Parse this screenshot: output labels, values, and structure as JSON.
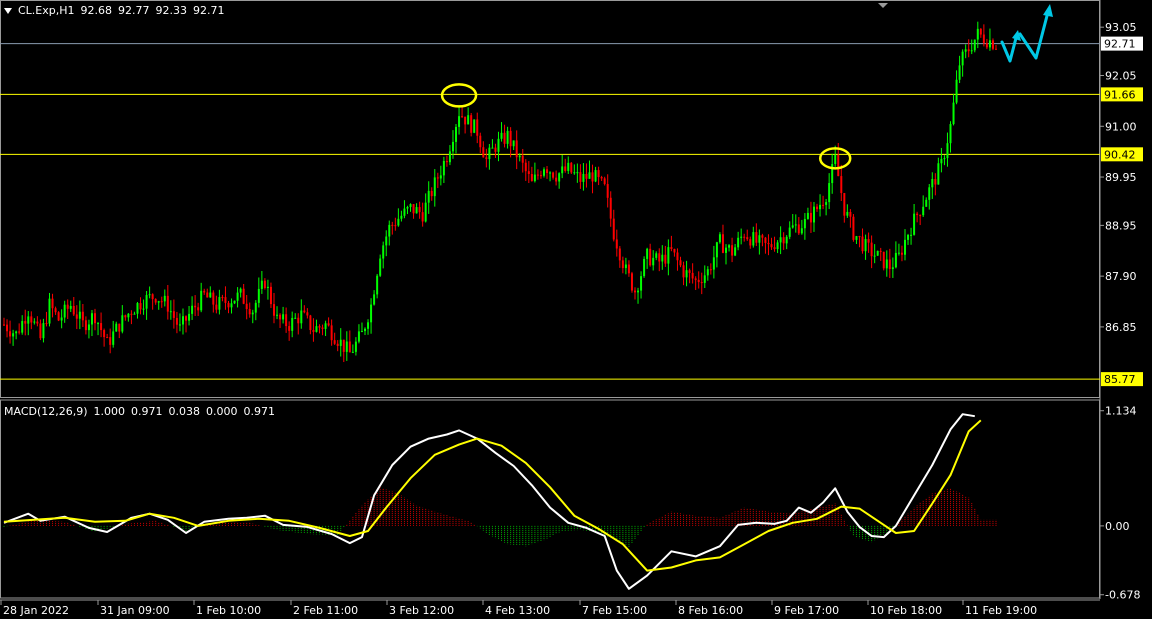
{
  "header": {
    "symbol": "CL.Exp,H1",
    "open": "92.68",
    "high": "92.77",
    "low": "92.33",
    "close": "92.71"
  },
  "macd_header": {
    "name": "MACD(12,26,9)",
    "v1": "1.000",
    "v2": "0.971",
    "v3": "0.038",
    "v4": "0.000",
    "v5": "0.971"
  },
  "colors": {
    "background": "#000000",
    "bull_candle": "#00ff00",
    "bear_candle": "#ff0000",
    "level_line": "#ffff00",
    "price_line": "#8a9bb0",
    "macd_line": "#ffffff",
    "signal_line": "#ffff00",
    "hist_pos": "#cc0000",
    "hist_neg": "#00aa00",
    "arrow": "#00c8e6"
  },
  "chart_data": [
    {
      "type": "candlestick",
      "title": "CL.Exp,H1",
      "ylim": [
        85.4,
        93.55
      ],
      "y_ticks": [
        "93.05",
        "92.05",
        "91.00",
        "89.95",
        "88.95",
        "87.90",
        "86.85"
      ],
      "y_tick_values": [
        93.05,
        92.05,
        91.0,
        89.95,
        88.95,
        87.9,
        86.85
      ],
      "x_ticks": [
        "28 Jan 2022",
        "31 Jan 09:00",
        "1 Feb 10:00",
        "2 Feb 11:00",
        "3 Feb 12:00",
        "4 Feb 13:00",
        "7 Feb 15:00",
        "8 Feb 16:00",
        "9 Feb 17:00",
        "10 Feb 18:00",
        "11 Feb 19:00"
      ],
      "horizontal_levels": [
        {
          "label": "91.66",
          "value": 91.66,
          "color": "#ffff00"
        },
        {
          "label": "90.42",
          "value": 90.42,
          "color": "#ffff00"
        },
        {
          "label": "85.77",
          "value": 85.77,
          "color": "#ffff00"
        }
      ],
      "current_price": {
        "label": "92.71",
        "value": 92.71
      },
      "close_path": [
        [
          0,
          86.9
        ],
        [
          4,
          86.7
        ],
        [
          8,
          87.2
        ],
        [
          12,
          86.6
        ],
        [
          15,
          87.3
        ],
        [
          18,
          87.0
        ],
        [
          22,
          87.3
        ],
        [
          26,
          86.9
        ],
        [
          30,
          87.1
        ],
        [
          34,
          86.5
        ],
        [
          38,
          86.9
        ],
        [
          42,
          87.2
        ],
        [
          46,
          87.4
        ],
        [
          50,
          87.5
        ],
        [
          54,
          87.3
        ],
        [
          58,
          86.8
        ],
        [
          62,
          87.2
        ],
        [
          66,
          87.5
        ],
        [
          70,
          87.3
        ],
        [
          74,
          87.4
        ],
        [
          78,
          87.5
        ],
        [
          82,
          87.2
        ],
        [
          86,
          87.8
        ],
        [
          90,
          87.0
        ],
        [
          94,
          86.9
        ],
        [
          98,
          87.1
        ],
        [
          102,
          86.8
        ],
        [
          106,
          86.9
        ],
        [
          110,
          86.6
        ],
        [
          114,
          86.3
        ],
        [
          118,
          86.7
        ],
        [
          121,
          87.3
        ],
        [
          124,
          88.4
        ],
        [
          127,
          88.9
        ],
        [
          130,
          89.1
        ],
        [
          134,
          89.3
        ],
        [
          138,
          89.2
        ],
        [
          142,
          89.8
        ],
        [
          146,
          90.4
        ],
        [
          150,
          91.3
        ],
        [
          153,
          91.1
        ],
        [
          156,
          90.9
        ],
        [
          159,
          90.3
        ],
        [
          162,
          90.6
        ],
        [
          166,
          90.8
        ],
        [
          170,
          90.3
        ],
        [
          174,
          89.8
        ],
        [
          178,
          90.2
        ],
        [
          182,
          90.0
        ],
        [
          186,
          90.1
        ],
        [
          190,
          89.9
        ],
        [
          194,
          90.0
        ],
        [
          198,
          89.7
        ],
        [
          201,
          88.8
        ],
        [
          205,
          88.0
        ],
        [
          208,
          87.6
        ],
        [
          212,
          88.3
        ],
        [
          216,
          88.2
        ],
        [
          220,
          88.4
        ],
        [
          224,
          88.0
        ],
        [
          228,
          87.8
        ],
        [
          232,
          88.0
        ],
        [
          236,
          88.6
        ],
        [
          240,
          88.4
        ],
        [
          244,
          88.8
        ],
        [
          248,
          88.6
        ],
        [
          252,
          88.5
        ],
        [
          256,
          88.7
        ],
        [
          260,
          88.9
        ],
        [
          264,
          89.0
        ],
        [
          268,
          89.3
        ],
        [
          271,
          89.6
        ],
        [
          274,
          90.3
        ],
        [
          277,
          89.3
        ],
        [
          280,
          88.8
        ],
        [
          284,
          88.5
        ],
        [
          288,
          88.3
        ],
        [
          292,
          88.1
        ],
        [
          295,
          88.3
        ],
        [
          298,
          88.8
        ],
        [
          302,
          89.3
        ],
        [
          306,
          89.8
        ],
        [
          309,
          90.2
        ],
        [
          312,
          91.0
        ],
        [
          315,
          92.3
        ],
        [
          318,
          92.6
        ],
        [
          321,
          92.9
        ],
        [
          324,
          92.8
        ],
        [
          327,
          92.71
        ]
      ],
      "forecast_arrows_count": 2
    },
    {
      "type": "line",
      "title": "MACD(12,26,9)",
      "ylim": [
        -0.72,
        1.22
      ],
      "y_ticks": [
        "1.134",
        "0.00",
        "-0.678"
      ],
      "y_tick_values": [
        1.134,
        0.0,
        -0.678
      ],
      "series": [
        {
          "name": "",
          "color": "#ffffff",
          "points": [
            [
              0,
              0.03
            ],
            [
              8,
              0.12
            ],
            [
              12,
              0.05
            ],
            [
              20,
              0.09
            ],
            [
              28,
              -0.02
            ],
            [
              34,
              -0.06
            ],
            [
              42,
              0.08
            ],
            [
              48,
              0.12
            ],
            [
              54,
              0.06
            ],
            [
              60,
              -0.07
            ],
            [
              66,
              0.04
            ],
            [
              74,
              0.07
            ],
            [
              80,
              0.08
            ],
            [
              86,
              0.1
            ],
            [
              92,
              0.01
            ],
            [
              100,
              -0.01
            ],
            [
              108,
              -0.08
            ],
            [
              114,
              -0.17
            ],
            [
              118,
              -0.11
            ],
            [
              122,
              0.3
            ],
            [
              128,
              0.6
            ],
            [
              134,
              0.78
            ],
            [
              140,
              0.86
            ],
            [
              146,
              0.9
            ],
            [
              150,
              0.94
            ],
            [
              156,
              0.86
            ],
            [
              162,
              0.72
            ],
            [
              168,
              0.59
            ],
            [
              174,
              0.4
            ],
            [
              180,
              0.18
            ],
            [
              186,
              0.03
            ],
            [
              192,
              -0.02
            ],
            [
              198,
              -0.1
            ],
            [
              202,
              -0.44
            ],
            [
              206,
              -0.62
            ],
            [
              212,
              -0.49
            ],
            [
              220,
              -0.25
            ],
            [
              228,
              -0.3
            ],
            [
              236,
              -0.2
            ],
            [
              242,
              0.01
            ],
            [
              248,
              0.03
            ],
            [
              254,
              0.02
            ],
            [
              258,
              0.05
            ],
            [
              262,
              0.18
            ],
            [
              266,
              0.13
            ],
            [
              270,
              0.23
            ],
            [
              274,
              0.37
            ],
            [
              278,
              0.14
            ],
            [
              282,
              -0.01
            ],
            [
              286,
              -0.1
            ],
            [
              290,
              -0.11
            ],
            [
              294,
              0.0
            ],
            [
              300,
              0.3
            ],
            [
              306,
              0.6
            ],
            [
              312,
              0.95
            ],
            [
              316,
              1.1
            ],
            [
              320,
              1.08
            ]
          ]
        },
        {
          "name": "",
          "color": "#ffff00",
          "points": [
            [
              0,
              0.04
            ],
            [
              10,
              0.06
            ],
            [
              20,
              0.08
            ],
            [
              30,
              0.04
            ],
            [
              40,
              0.05
            ],
            [
              48,
              0.12
            ],
            [
              56,
              0.08
            ],
            [
              64,
              0.0
            ],
            [
              74,
              0.05
            ],
            [
              84,
              0.07
            ],
            [
              94,
              0.05
            ],
            [
              104,
              -0.02
            ],
            [
              114,
              -0.1
            ],
            [
              120,
              -0.05
            ],
            [
              126,
              0.18
            ],
            [
              134,
              0.47
            ],
            [
              142,
              0.7
            ],
            [
              150,
              0.8
            ],
            [
              156,
              0.86
            ],
            [
              164,
              0.79
            ],
            [
              172,
              0.62
            ],
            [
              180,
              0.38
            ],
            [
              188,
              0.1
            ],
            [
              196,
              -0.03
            ],
            [
              204,
              -0.18
            ],
            [
              212,
              -0.44
            ],
            [
              220,
              -0.41
            ],
            [
              228,
              -0.34
            ],
            [
              236,
              -0.31
            ],
            [
              244,
              -0.18
            ],
            [
              252,
              -0.05
            ],
            [
              260,
              0.03
            ],
            [
              268,
              0.07
            ],
            [
              276,
              0.19
            ],
            [
              282,
              0.17
            ],
            [
              288,
              0.05
            ],
            [
              294,
              -0.07
            ],
            [
              300,
              -0.05
            ],
            [
              306,
              0.22
            ],
            [
              312,
              0.5
            ],
            [
              318,
              0.93
            ],
            [
              322,
              1.04
            ]
          ]
        }
      ],
      "histogram": [
        [
          0,
          -0.01
        ],
        [
          10,
          0.06
        ],
        [
          20,
          0.04
        ],
        [
          30,
          -0.06
        ],
        [
          40,
          0.02
        ],
        [
          50,
          0.05
        ],
        [
          60,
          -0.05
        ],
        [
          70,
          0.04
        ],
        [
          80,
          0.04
        ],
        [
          90,
          -0.04
        ],
        [
          100,
          -0.08
        ],
        [
          110,
          -0.09
        ],
        [
          118,
          0.2
        ],
        [
          124,
          0.38
        ],
        [
          130,
          0.32
        ],
        [
          136,
          0.2
        ],
        [
          142,
          0.14
        ],
        [
          148,
          0.09
        ],
        [
          154,
          0.04
        ],
        [
          160,
          -0.09
        ],
        [
          166,
          -0.18
        ],
        [
          172,
          -0.2
        ],
        [
          178,
          -0.14
        ],
        [
          184,
          -0.05
        ],
        [
          190,
          -0.04
        ],
        [
          196,
          -0.06
        ],
        [
          202,
          -0.15
        ],
        [
          206,
          -0.21
        ],
        [
          212,
          0.02
        ],
        [
          220,
          0.14
        ],
        [
          228,
          0.1
        ],
        [
          236,
          0.08
        ],
        [
          244,
          0.18
        ],
        [
          252,
          0.14
        ],
        [
          260,
          0.12
        ],
        [
          268,
          0.18
        ],
        [
          274,
          0.22
        ],
        [
          280,
          -0.1
        ],
        [
          286,
          -0.16
        ],
        [
          292,
          -0.05
        ],
        [
          300,
          0.18
        ],
        [
          306,
          0.32
        ],
        [
          312,
          0.37
        ],
        [
          318,
          0.28
        ],
        [
          322,
          0.06
        ]
      ]
    }
  ]
}
